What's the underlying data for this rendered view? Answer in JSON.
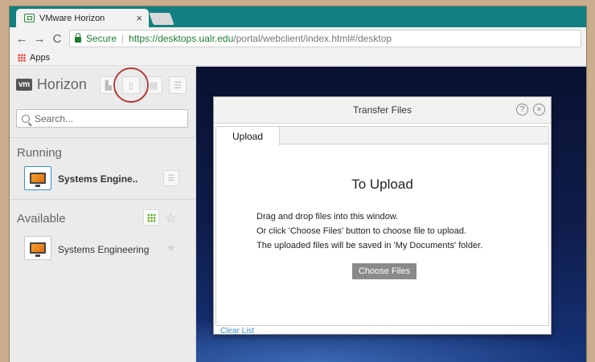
{
  "browser": {
    "tab_title": "VMware Horizon",
    "tab_close": "×",
    "nav": {
      "back": "←",
      "forward": "→",
      "reload": "C"
    },
    "secure_label": "Secure",
    "url_scheme": "https://",
    "url_host": "desktops.ualr.edu",
    "url_path": "/portal/webclient/index.html#/desktop",
    "bookmark_apps": "Apps"
  },
  "sidebar": {
    "logo": "vm",
    "brand": "Horizon",
    "search_placeholder": "Search...",
    "running": {
      "title": "Running",
      "app_name": "Systems Engine.."
    },
    "available": {
      "title": "Available",
      "app_name": "Systems Engineering"
    },
    "tool_glyphs": {
      "list": "☰",
      "star": "☆",
      "star_filled": "★"
    }
  },
  "dialog": {
    "title": "Transfer Files",
    "help": "?",
    "close": "×",
    "tab_upload": "Upload",
    "heading": "To Upload",
    "line1": "Drag and drop files into this window.",
    "line2": "Or click 'Choose Files' button to choose file to upload.",
    "line3": "The uploaded files will be saved in 'My Documents' folder.",
    "choose_files": "Choose Files",
    "clear_list": "Clear List"
  },
  "colors": {
    "tabstrip": "#128080",
    "secure_green": "#1e7d32",
    "highlight_ring": "#b23b3b",
    "link_blue": "#3a8fd1"
  }
}
